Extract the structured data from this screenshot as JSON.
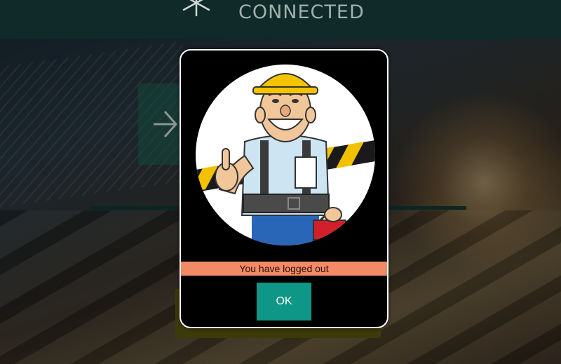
{
  "header": {
    "title": "CONNECTED",
    "icon": "asterisk-icon"
  },
  "background": {
    "arrow_tile_icon": "arrow-right-icon"
  },
  "modal": {
    "image": "worker-illustration",
    "message": "You have logged out",
    "ok_label": "OK"
  },
  "colors": {
    "header_bg": "#0f2a28",
    "message_bg": "#f28a66",
    "ok_button_bg": "#0e9686",
    "modal_bg": "#000000"
  }
}
